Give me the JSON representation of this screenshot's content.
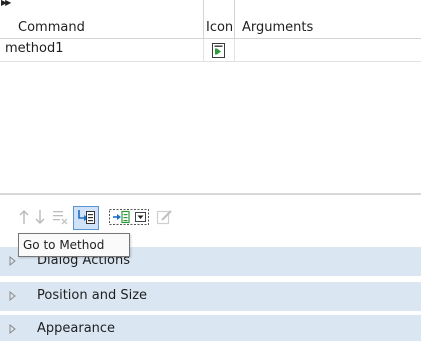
{
  "table": {
    "columns": [
      "Command",
      "Icon",
      "Arguments"
    ],
    "rows": [
      {
        "command": "method1",
        "icon": "method-icon",
        "arguments": ""
      }
    ]
  },
  "toolbar": {
    "buttons": [
      {
        "icon": "move-up-icon"
      },
      {
        "icon": "move-down-icon"
      },
      {
        "icon": "delete-icon"
      },
      {
        "icon": "go-to-method-icon"
      },
      {
        "icon": "add-command-icon",
        "dropdown": true
      },
      {
        "icon": "edit-icon"
      }
    ]
  },
  "tooltip": {
    "text": "Go to Method"
  },
  "sections": [
    {
      "label": "Dialog Actions"
    },
    {
      "label": "Position and Size"
    },
    {
      "label": "Appearance"
    }
  ],
  "colors": {
    "section_bg": "#dbe6f3",
    "accent_blue": "#1e6ec8",
    "accent_green": "#2e9a3a"
  }
}
